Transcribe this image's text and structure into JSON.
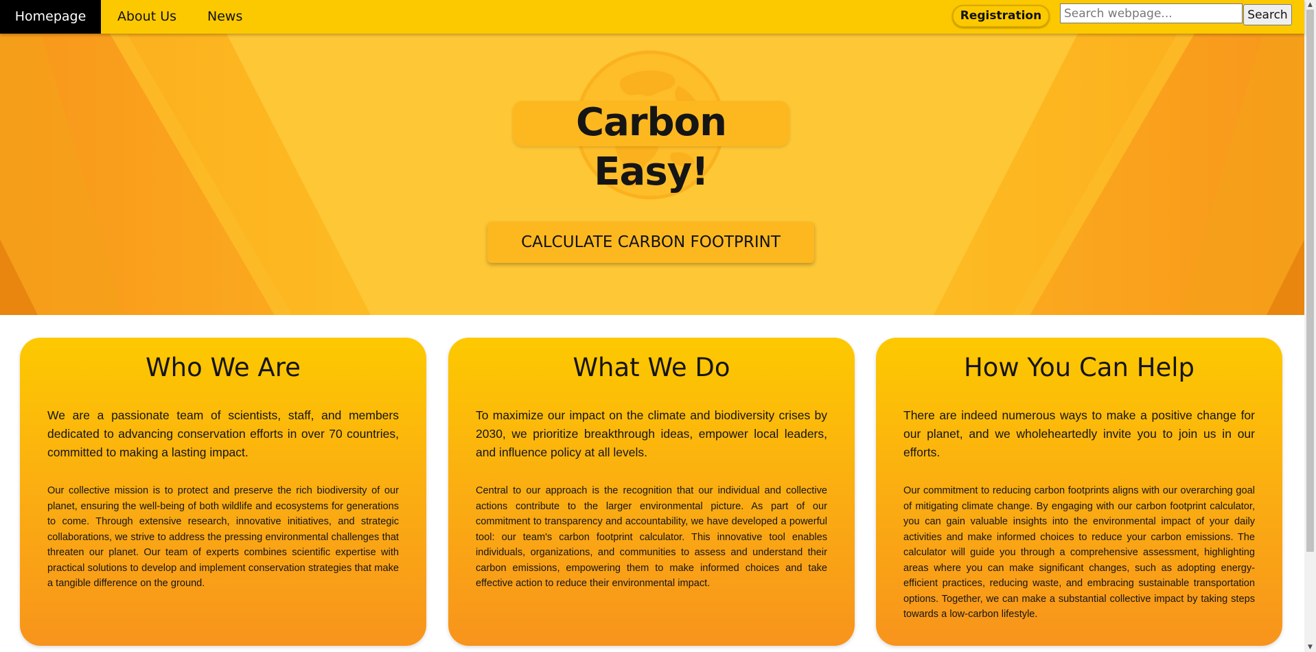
{
  "nav": {
    "links": [
      {
        "label": "Homepage",
        "active": true
      },
      {
        "label": "About Us",
        "active": false
      },
      {
        "label": "News",
        "active": false
      }
    ],
    "registration_label": "Registration",
    "search": {
      "placeholder": "Search webpage...",
      "value": "",
      "button_label": "Search"
    }
  },
  "hero": {
    "title": "Carbon Easy!",
    "cta_label": "CALCULATE CARBON FOOTPRINT",
    "background_icon": "globe-icon"
  },
  "cards": [
    {
      "title": "Who We Are",
      "lead": "We are a passionate team of scientists, staff, and members dedicated to advancing conservation efforts in over 70 countries, committed to making a lasting impact.",
      "body": "Our collective mission is to protect and preserve the rich biodiversity of our planet, ensuring the well-being of both wildlife and ecosystems for generations to come. Through extensive research, innovative initiatives, and strategic collaborations, we strive to address the pressing environmental challenges that threaten our planet. Our team of experts combines scientific expertise with practical solutions to develop and implement conservation strategies that make a tangible difference on the ground."
    },
    {
      "title": "What We Do",
      "lead": "To maximize our impact on the climate and biodiversity crises by 2030, we prioritize breakthrough ideas, empower local leaders, and influence policy at all levels.",
      "body": "Central to our approach is the recognition that our individual and collective actions contribute to the larger environmental picture. As part of our commitment to transparency and accountability, we have developed a powerful tool: our team's carbon footprint calculator. This innovative tool enables individuals, organizations, and communities to assess and understand their carbon emissions, empowering them to make informed choices and take effective action to reduce their environmental impact."
    },
    {
      "title": "How You Can Help",
      "lead": "There are indeed numerous ways to make a positive change for our planet, and we wholeheartedly invite you to join us in our efforts.",
      "body": "Our commitment to reducing carbon footprints aligns with our overarching goal of mitigating climate change. By engaging with our carbon footprint calculator, you can gain valuable insights into the environmental impact of your daily activities and make informed choices to reduce your carbon emissions. The calculator will guide you through a comprehensive assessment, highlighting areas where you can make significant changes, such as adopting energy-efficient practices, reducing waste, and embracing sustainable transportation options. Together, we can make a substantial collective impact by taking steps towards a low-carbon lifestyle."
    }
  ],
  "colors": {
    "nav_bg": "#fcc900",
    "active_nav_bg": "#000000",
    "hero_bg": "#fdc736",
    "card_gradient_top": "#fdc900",
    "card_gradient_bottom": "#f8941c",
    "button_bg": "#fdb820"
  }
}
